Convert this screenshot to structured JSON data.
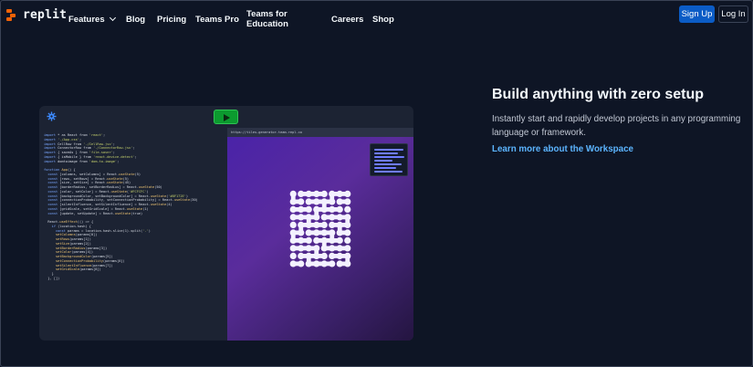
{
  "brand": {
    "name": "replit"
  },
  "nav": {
    "features": "Features",
    "blog": "Blog",
    "pricing": "Pricing",
    "teams_pro": "Teams Pro",
    "teams_education": "Teams for Education",
    "careers": "Careers",
    "shop": "Shop",
    "signup": "Sign Up",
    "login": "Log In"
  },
  "colors": {
    "brand_orange": "#f26207",
    "accent_blue": "#0b5cc6",
    "link_blue": "#5cb5ff",
    "run_green": "#0c9a2f"
  },
  "workspace": {
    "run_icon": "play-icon",
    "settings_icon": "gear-icon",
    "preview_url": "https://tiles-generator.team.repl.co"
  },
  "hero": {
    "title": "Build anything with zero setup",
    "description": "Instantly start and rapidly develop projects in any programming language or framework.",
    "link": "Learn more about the Workspace"
  }
}
